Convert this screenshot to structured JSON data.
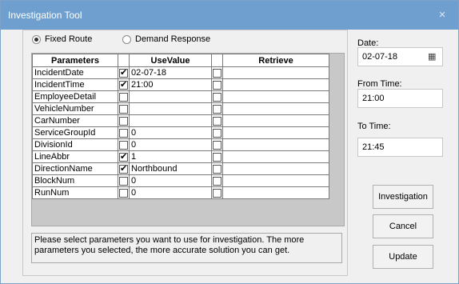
{
  "window": {
    "title": "Investigation Tool",
    "close_glyph": "×"
  },
  "mode": {
    "options": [
      {
        "label": "Fixed Route",
        "selected": true
      },
      {
        "label": "Demand Response",
        "selected": false
      }
    ]
  },
  "grid": {
    "headers": {
      "parameters": "Parameters",
      "use_value": "UseValue",
      "retrieve": "Retrieve"
    },
    "rows": [
      {
        "name": "IncidentDate",
        "use": true,
        "value": "02-07-18",
        "retrieve": false
      },
      {
        "name": "IncidentTime",
        "use": true,
        "value": "21:00",
        "retrieve": false
      },
      {
        "name": "EmployeeDetail",
        "use": false,
        "value": "",
        "retrieve": false
      },
      {
        "name": "VehicleNumber",
        "use": false,
        "value": "",
        "retrieve": false
      },
      {
        "name": "CarNumber",
        "use": false,
        "value": "",
        "retrieve": false
      },
      {
        "name": "ServiceGroupId",
        "use": false,
        "value": "0",
        "retrieve": false
      },
      {
        "name": "DivisionId",
        "use": false,
        "value": "0",
        "retrieve": false
      },
      {
        "name": "LineAbbr",
        "use": true,
        "value": "1",
        "retrieve": false
      },
      {
        "name": "DirectionName",
        "use": true,
        "value": "Northbound",
        "retrieve": false
      },
      {
        "name": "BlockNum",
        "use": false,
        "value": "0",
        "retrieve": false
      },
      {
        "name": "RunNum",
        "use": false,
        "value": "0",
        "retrieve": false
      }
    ]
  },
  "info_text": "Please select parameters you want to use for investigation. The more parameters you selected, the more accurate solution you can get.",
  "date": {
    "label": "Date:",
    "value": "02-07-18"
  },
  "from_time": {
    "label": "From Time:",
    "value": "21:00"
  },
  "to_time": {
    "label": "To Time:",
    "value": "21:45"
  },
  "buttons": {
    "investigation": "Investigation",
    "cancel": "Cancel",
    "update": "Update"
  },
  "colors": {
    "titlebar": "#6f9fce",
    "background": "#f0f0f0"
  }
}
